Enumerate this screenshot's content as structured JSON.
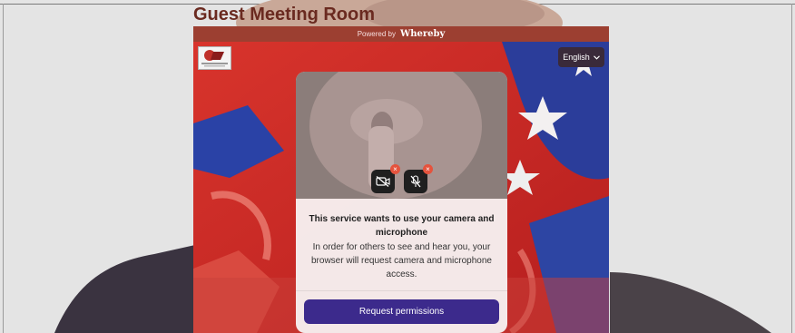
{
  "page": {
    "title": "Guest Meeting Room"
  },
  "embed": {
    "powered_by_prefix": "Powered by",
    "powered_by_brand": "Whereby",
    "language_button": "English",
    "language_icon": "chevron-down-icon",
    "logo": "org-logo"
  },
  "permission_card": {
    "title": "This service wants to use your camera and microphone",
    "body": "In order for others to see and hear you, your browser will request camera and microphone access.",
    "camera_icon": "camera-off-icon",
    "mic_icon": "mic-off-icon",
    "error_badge": "×",
    "button_label": "Request permissions"
  },
  "colors": {
    "title": "#6a2a20",
    "powered_bar": "#9c3f31",
    "button": "#3c2a8c",
    "error_badge": "#e5533d"
  }
}
